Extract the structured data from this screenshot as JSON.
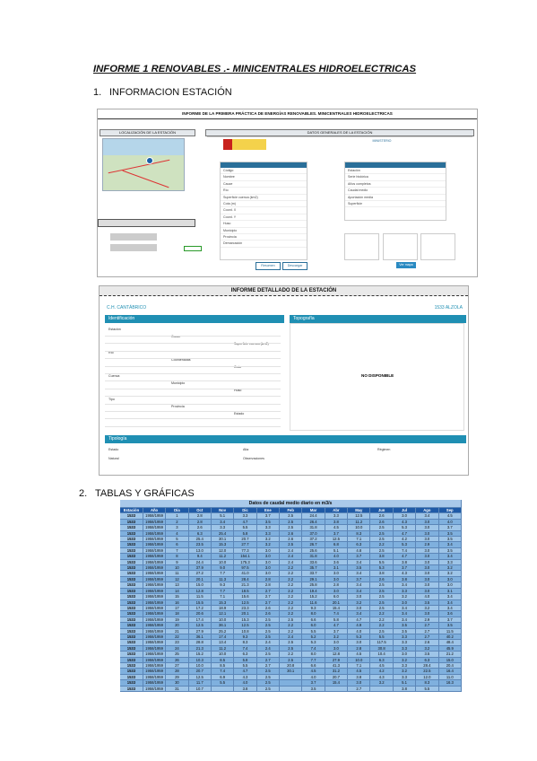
{
  "heading": "INFORME 1 RENOVABLES .- MINICENTRALES HIDROELECTRICAS",
  "section1": {
    "number": "1.",
    "title": "INFORMACION ESTACIÓN"
  },
  "section2": {
    "number": "2.",
    "title": "TABLAS Y GRÁFICAS"
  },
  "shot1": {
    "title": "INFORME DE LA PRIMERA PRÁCTICA DE ENERGÍAS RENOVABLES. MINICENTRALES HIDROELECTRICAS",
    "loc_label": "LOCALIZACIÓN DE LA ESTACIÓN",
    "data_label": "DATOS GENERALES DE LA ESTACIÓN",
    "left_rows": [
      "Código",
      "Nombre",
      "Cauce",
      "Río",
      "Superficie cuenca (km2)",
      "Cota (m)",
      "Coord. X",
      "Coord. Y",
      "Huso",
      "Municipio",
      "Provincia",
      "Demarcación"
    ],
    "right_rows": [
      "Estación",
      "Serie histórica",
      "Años completos",
      "Caudal medio",
      "Aportación media",
      "Superficie"
    ],
    "btn1": "Resumen",
    "btn2": "Descargar",
    "btn3": "Ver mapa",
    "ministry": "MINISTERIO"
  },
  "shot2": {
    "title": "INFORME DETALLADO DE LA ESTACIÓN",
    "subtitle_left": "C.H. CANTÁBRICO",
    "subtitle_right": "1533 ALZOLA",
    "ident": "Identificación",
    "topo": "Topografía",
    "not_available": "NO DISPONIBLE",
    "fields_a": [
      "Estación",
      "Río",
      "Cuenca",
      "Tipo"
    ],
    "fields_b": [
      "Cauce",
      "Coordenadas",
      "Municipio",
      "Provincia"
    ],
    "fields_c": [
      "Superficie cuenca (km2)",
      "Cota",
      "Huso",
      "Estado"
    ],
    "bottom_head": "Tipología",
    "bottom": [
      "Estado",
      "Alta",
      "Régimen",
      "Natural",
      "Observaciones"
    ]
  },
  "table": {
    "caption": "Datos de caudal medio diario en m3/s",
    "headers": [
      "Estación",
      "Año",
      "Día",
      "Oct",
      "Nov",
      "Dic",
      "Ene",
      "Feb",
      "Mar",
      "Abr",
      "May",
      "Jun",
      "Jul",
      "Ago",
      "Sep"
    ],
    "rows": [
      [
        "1533",
        "1958/1959",
        "1",
        "2.8",
        "5.1",
        "3.3",
        "3.7",
        "2.5",
        "24.4",
        "3.3",
        "12.5",
        "2.6",
        "3.0",
        "3.4",
        "4.5"
      ],
      [
        "1533",
        "1958/1959",
        "2",
        "2.8",
        "3.4",
        "4.7",
        "3.5",
        "2.5",
        "26.4",
        "3.8",
        "11.2",
        "2.6",
        "4.3",
        "3.0",
        "4.0"
      ],
      [
        "1533",
        "1958/1959",
        "3",
        "2.6",
        "3.3",
        "5.5",
        "3.3",
        "2.5",
        "31.8",
        "4.5",
        "10.0",
        "2.5",
        "5.3",
        "3.0",
        "3.7"
      ],
      [
        "1533",
        "1958/1959",
        "4",
        "6.3",
        "25.4",
        "5.8",
        "3.3",
        "2.6",
        "37.0",
        "3.7",
        "8.3",
        "2.5",
        "4.7",
        "3.0",
        "3.5"
      ],
      [
        "1533",
        "1958/1959",
        "5",
        "25.4",
        "30.1",
        "20.7",
        "3.2",
        "2.6",
        "37.2",
        "12.5",
        "7.1",
        "2.5",
        "4.2",
        "3.0",
        "3.5"
      ],
      [
        "1533",
        "1958/1959",
        "6",
        "23.5",
        "15.3",
        "27.7",
        "3.2",
        "2.5",
        "26.7",
        "6.8",
        "6.3",
        "2.2",
        "5.3",
        "2.9",
        "3.4"
      ],
      [
        "1533",
        "1958/1959",
        "7",
        "13.0",
        "12.0",
        "77.3",
        "3.0",
        "2.4",
        "25.6",
        "5.1",
        "4.8",
        "2.5",
        "7.4",
        "3.0",
        "3.5"
      ],
      [
        "1533",
        "1958/1959",
        "8",
        "9.4",
        "11.2",
        "154.1",
        "3.0",
        "2.4",
        "31.8",
        "4.0",
        "3.7",
        "3.8",
        "4.7",
        "3.0",
        "3.4"
      ],
      [
        "1533",
        "1958/1959",
        "9",
        "24.4",
        "10.0",
        "175.3",
        "3.0",
        "2.4",
        "33.6",
        "3.6",
        "3.4",
        "5.5",
        "3.8",
        "3.0",
        "3.3"
      ],
      [
        "1533",
        "1958/1959",
        "10",
        "37.9",
        "9.0",
        "97.5",
        "3.0",
        "2.2",
        "35.7",
        "3.1",
        "3.5",
        "5.3",
        "3.7",
        "3.0",
        "3.2"
      ],
      [
        "1533",
        "1958/1959",
        "11",
        "27.2",
        "7.7",
        "41.0",
        "3.0",
        "2.2",
        "33.7",
        "3.0",
        "3.4",
        "3.8",
        "4.3",
        "3.0",
        "3.2"
      ],
      [
        "1533",
        "1958/1959",
        "12",
        "20.1",
        "11.3",
        "28.4",
        "2.8",
        "2.2",
        "29.1",
        "3.0",
        "3.7",
        "2.6",
        "3.8",
        "3.0",
        "3.0"
      ],
      [
        "1533",
        "1958/1959",
        "13",
        "15.0",
        "9.3",
        "21.3",
        "2.8",
        "2.2",
        "25.8",
        "2.8",
        "3.4",
        "2.5",
        "3.4",
        "3.0",
        "3.0"
      ],
      [
        "1533",
        "1958/1959",
        "14",
        "12.8",
        "7.7",
        "18.5",
        "2.7",
        "2.2",
        "19.4",
        "3.0",
        "3.4",
        "2.5",
        "3.3",
        "3.0",
        "3.1"
      ],
      [
        "1533",
        "1958/1959",
        "15",
        "11.5",
        "7.1",
        "15.6",
        "2.7",
        "2.2",
        "15.2",
        "6.0",
        "3.0",
        "2.5",
        "3.2",
        "4.0",
        "3.4"
      ],
      [
        "1533",
        "1958/1959",
        "16",
        "15.5",
        "15.3",
        "12.5",
        "2.7",
        "2.2",
        "11.6",
        "20.1",
        "3.2",
        "2.5",
        "3.0",
        "3.5",
        "3.4"
      ],
      [
        "1533",
        "1958/1959",
        "17",
        "17.2",
        "18.9",
        "23.3",
        "2.6",
        "2.2",
        "9.3",
        "15.4",
        "3.0",
        "2.5",
        "3.4",
        "3.2",
        "3.4"
      ],
      [
        "1533",
        "1958/1959",
        "18",
        "20.6",
        "12.1",
        "20.1",
        "2.6",
        "2.2",
        "8.0",
        "7.4",
        "3.4",
        "2.2",
        "3.4",
        "3.0",
        "3.6"
      ],
      [
        "1533",
        "1958/1959",
        "19",
        "17.4",
        "10.0",
        "15.3",
        "2.5",
        "2.5",
        "6.6",
        "5.8",
        "4.7",
        "2.2",
        "3.4",
        "2.9",
        "3.7"
      ],
      [
        "1533",
        "1958/1959",
        "20",
        "12.5",
        "36.1",
        "12.5",
        "2.5",
        "2.2",
        "6.0",
        "4.7",
        "4.9",
        "2.2",
        "3.5",
        "2.7",
        "3.5"
      ],
      [
        "1533",
        "1958/1959",
        "21",
        "27.9",
        "25.2",
        "10.8",
        "2.5",
        "2.2",
        "5.5",
        "3.7",
        "4.0",
        "2.5",
        "3.5",
        "2.7",
        "11.5"
      ],
      [
        "1533",
        "1958/1959",
        "22",
        "36.1",
        "17.4",
        "9.3",
        "2.5",
        "2.4",
        "5.2",
        "3.2",
        "5.3",
        "5.5",
        "3.3",
        "2.7",
        "40.2"
      ],
      [
        "1533",
        "1958/1959",
        "23",
        "28.8",
        "13.4",
        "8.3",
        "2.4",
        "2.5",
        "5.3",
        "3.0",
        "3.0",
        "117.5",
        "3.3",
        "2.6",
        "48.4"
      ],
      [
        "1533",
        "1958/1959",
        "24",
        "21.3",
        "11.2",
        "7.4",
        "2.4",
        "2.5",
        "7.4",
        "3.0",
        "2.8",
        "30.8",
        "3.3",
        "3.2",
        "45.9"
      ],
      [
        "1533",
        "1958/1959",
        "25",
        "15.2",
        "10.0",
        "6.3",
        "2.5",
        "2.2",
        "8.0",
        "12.8",
        "4.5",
        "10.4",
        "3.0",
        "3.5",
        "21.2"
      ],
      [
        "1533",
        "1958/1959",
        "26",
        "10.3",
        "8.5",
        "5.8",
        "2.7",
        "2.5",
        "7.7",
        "27.9",
        "10.0",
        "6.3",
        "3.2",
        "6.3",
        "15.0"
      ],
      [
        "1533",
        "1958/1959",
        "27",
        "10.0",
        "8.5",
        "5.5",
        "2.7",
        "20.8",
        "6.6",
        "41.3",
        "7.1",
        "4.5",
        "3.3",
        "28.4",
        "20.4"
      ],
      [
        "1533",
        "1958/1959",
        "28",
        "20.7",
        "7.4",
        "4.7",
        "2.5",
        "30.1",
        "4.5",
        "31.2",
        "4.5",
        "4.2",
        "3.2",
        "22.5",
        "16.4"
      ],
      [
        "1533",
        "1958/1959",
        "29",
        "12.5",
        "6.9",
        "4.3",
        "2.5",
        "",
        "4.0",
        "20.7",
        "3.8",
        "4.3",
        "3.3",
        "12.0",
        "11.0"
      ],
      [
        "1533",
        "1958/1959",
        "30",
        "11.7",
        "5.5",
        "4.0",
        "2.5",
        "",
        "3.7",
        "15.4",
        "3.0",
        "3.2",
        "5.1",
        "8.3",
        "16.3"
      ],
      [
        "1533",
        "1958/1959",
        "31",
        "10.7",
        "",
        "3.8",
        "2.5",
        "",
        "3.5",
        "",
        "2.7",
        "",
        "3.8",
        "5.5",
        ""
      ]
    ]
  }
}
